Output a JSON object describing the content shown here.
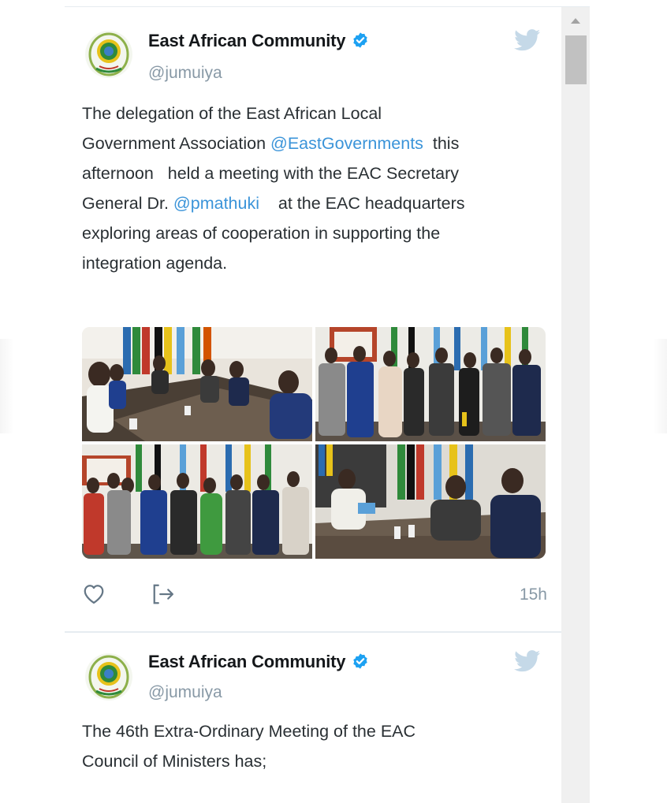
{
  "tweets": [
    {
      "display_name": "East African Community",
      "handle": "@jumuiya",
      "text": [
        {
          "t": "The delegation of the East African Local\nGovernment Association ",
          "mention": false
        },
        {
          "t": "@EastGovernments",
          "mention": true
        },
        {
          "t": "  this\nafternoon   held a meeting with the EAC Secretary\nGeneral Dr. ",
          "mention": false
        },
        {
          "t": "@pmathuki",
          "mention": true
        },
        {
          "t": "    at the EAC headquarters\nexploring areas of cooperation in supporting the\nintegration agenda.",
          "mention": false
        }
      ],
      "timestamp": "15h",
      "media_count": 4
    },
    {
      "display_name": "East African Community",
      "handle": "@jumuiya",
      "text": [
        {
          "t": "The 46th Extra-Ordinary Meeting of the EAC\nCouncil of Ministers has;",
          "mention": false
        }
      ]
    }
  ],
  "icons": {
    "verified": "verified-badge-icon",
    "twitter": "twitter-bird-icon",
    "like": "heart-icon",
    "share": "share-icon"
  },
  "colors": {
    "text": "#292f33",
    "name": "#14171a",
    "muted": "#8899a6",
    "link": "#3b94d9",
    "verified": "#1da1f2",
    "bird": "#c5d9e8",
    "divider": "#e6ecf0"
  }
}
